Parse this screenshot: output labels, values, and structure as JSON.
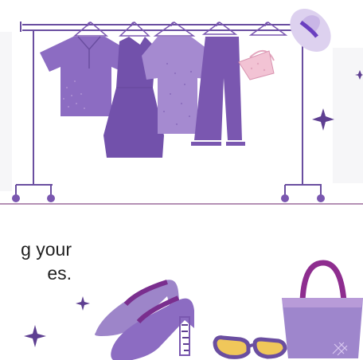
{
  "caption": {
    "line1": "g your",
    "line2": "es."
  },
  "colors": {
    "primary_purple": "#7a57b0",
    "light_purple": "#9e86cc",
    "dark_purple": "#5e3f91",
    "lavender": "#b89bd8",
    "rack_line": "#6a4ea0",
    "floor_line": "#9b6b9b",
    "pink": "#f2c3d4",
    "yellow": "#f0c75a",
    "magenta": "#8e2d8f"
  },
  "icons": [
    "shirt-icon",
    "dress-icon",
    "blouse-icon",
    "trousers-icon",
    "purse-icon",
    "hat-icon",
    "sparkle-icon",
    "high-heels-icon",
    "sunglasses-icon",
    "tote-bag-icon"
  ]
}
